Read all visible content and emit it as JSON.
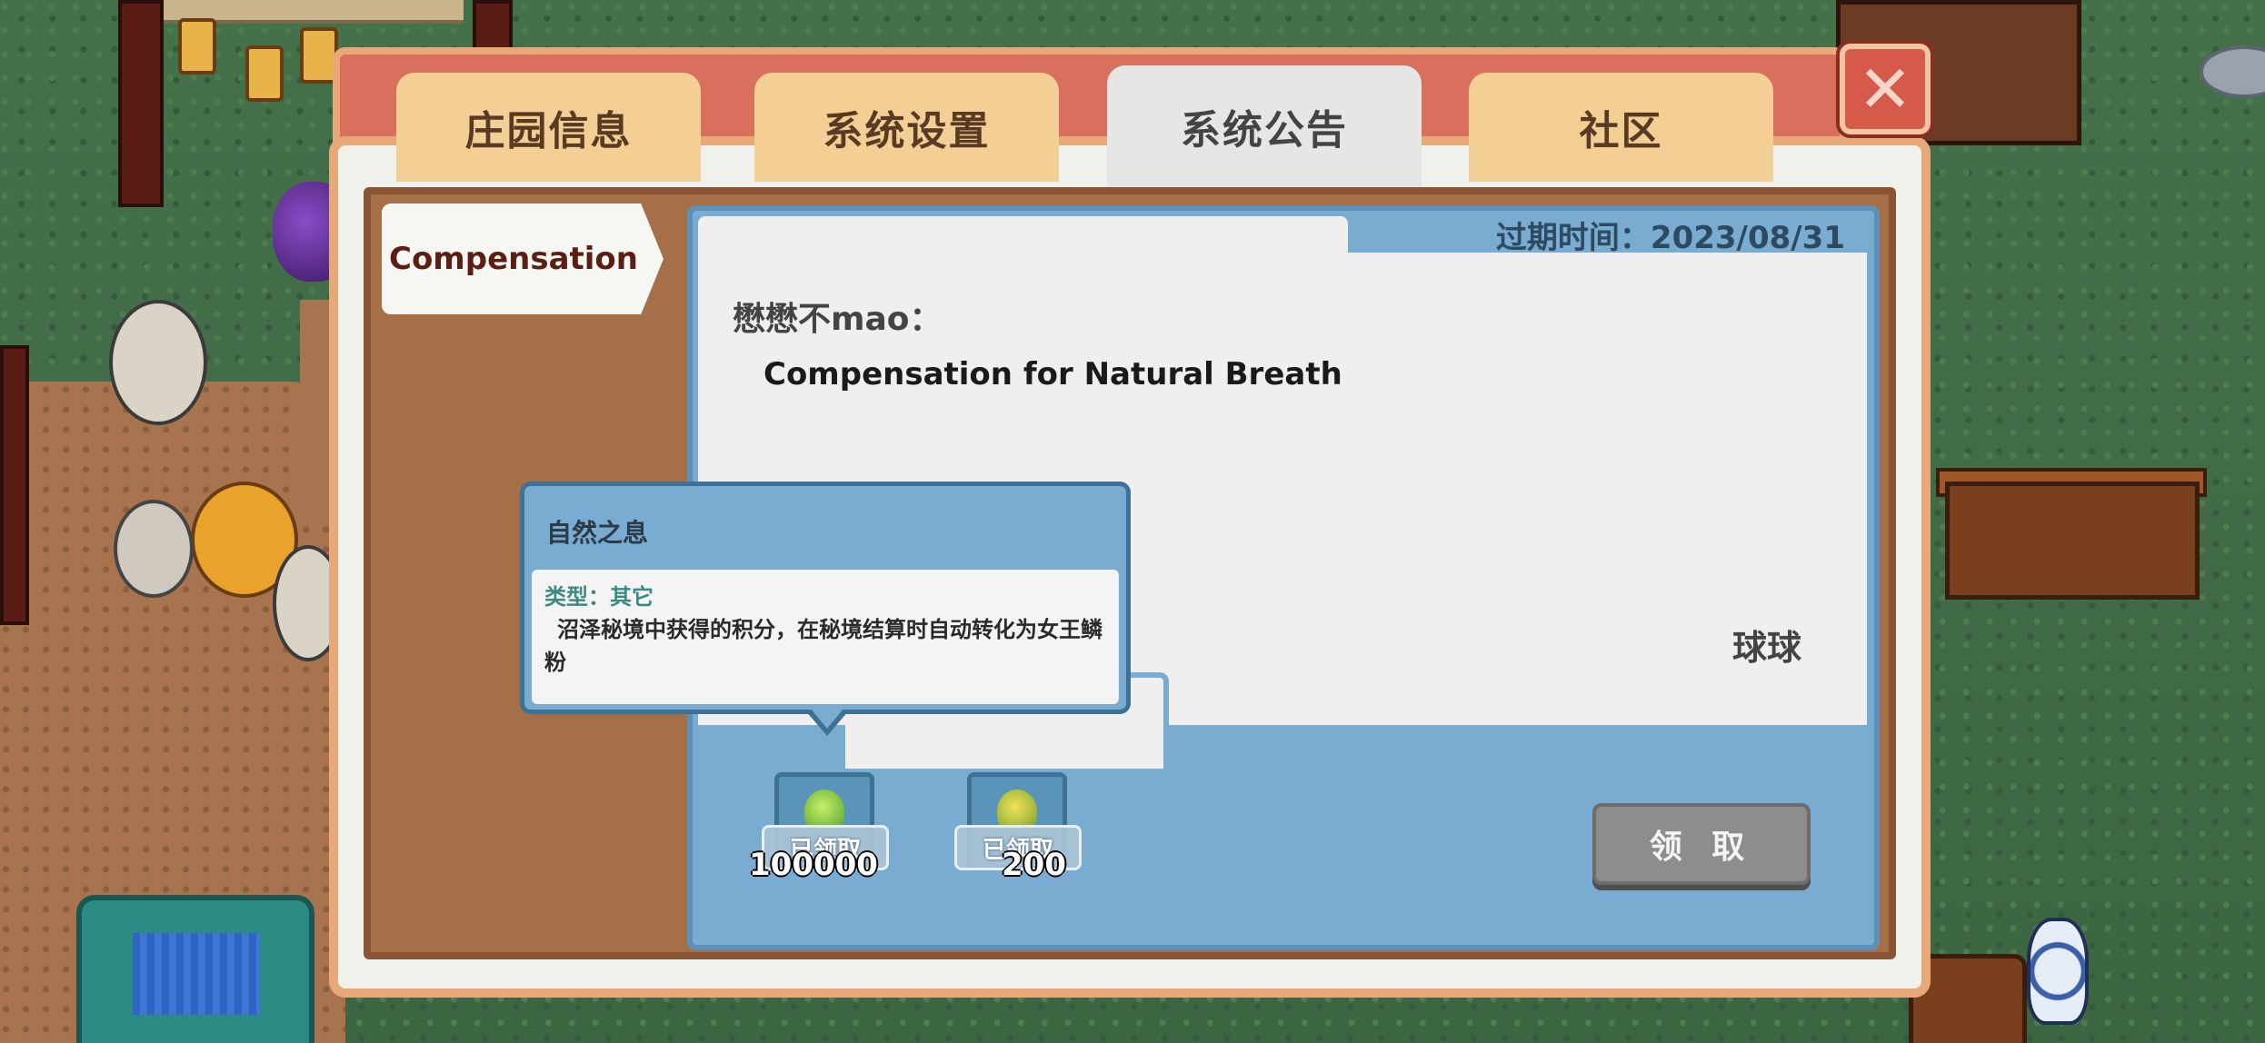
{
  "tabs": [
    {
      "label": "庄园信息"
    },
    {
      "label": "系统设置"
    },
    {
      "label": "系统公告",
      "active": true
    },
    {
      "label": "社区"
    }
  ],
  "close_icon": "close-icon",
  "sidebar": {
    "items": [
      {
        "label": "Compensation"
      }
    ]
  },
  "mail": {
    "expire": "过期时间：2023/08/31",
    "sender": "懋懋不mao：",
    "body": "Compensation for Natural Breath",
    "signature": "球球"
  },
  "rewards": [
    {
      "icon": "green-crystal-icon",
      "count": "100000",
      "claimed_label": "已领取"
    },
    {
      "icon": "gold-crystal-icon",
      "count": "200",
      "claimed_label": "已领取"
    }
  ],
  "claim_button": {
    "label": "领 取"
  },
  "tooltip": {
    "title": "自然之息",
    "type": "类型：其它",
    "description": "沼泽秘境中获得的积分，在秘境结算时自动转化为女王鳞粉"
  },
  "colors": {
    "frame": "#e8a878",
    "header": "#d9705d",
    "tab": "#f3cf96",
    "tab_active": "#e6e6e4",
    "mail_blue": "#79acd0",
    "button_disabled": "#8d8d8d"
  }
}
